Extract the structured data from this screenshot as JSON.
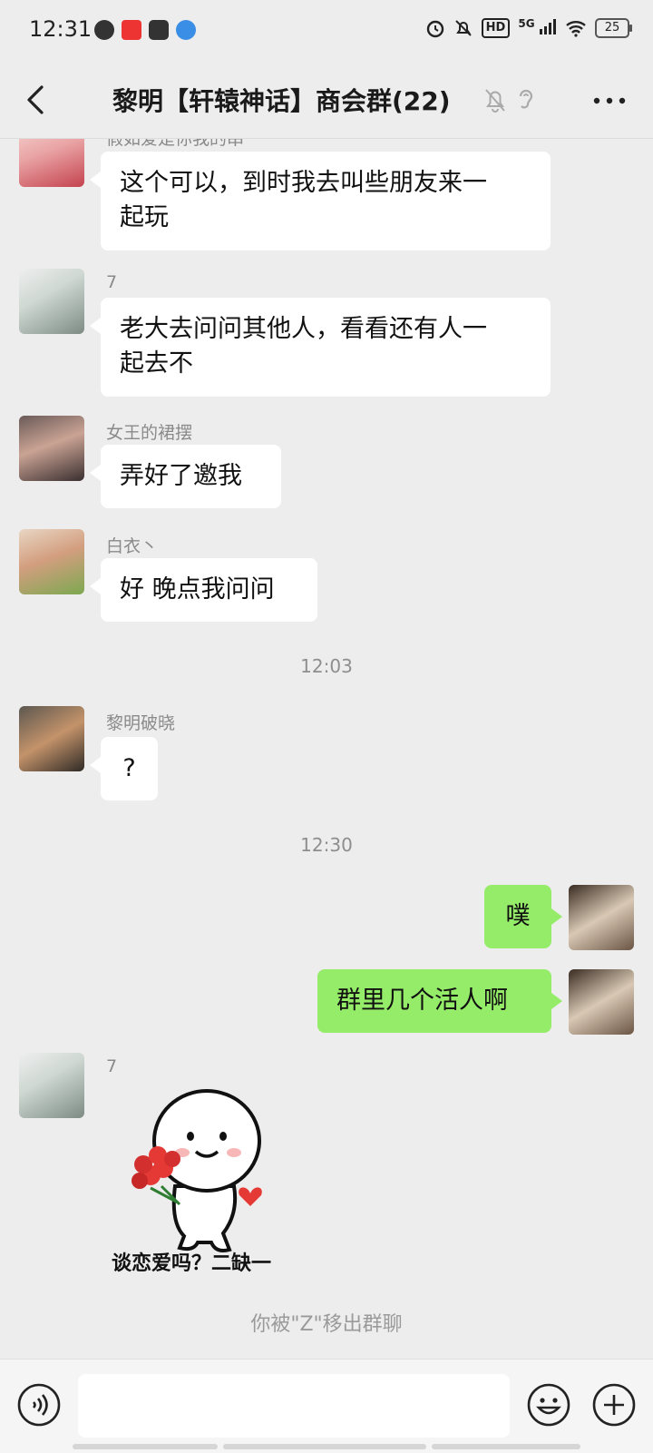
{
  "status_bar": {
    "time": "12:31",
    "network": "5G",
    "hd": "HD",
    "battery": "25"
  },
  "header": {
    "title": "黎明【轩辕神话】商会群(22)"
  },
  "messages": [
    {
      "sender": "假如爱是你我的串",
      "text_line1": "这个可以，到时我去叫些朋友来一",
      "text_line2": "起玩"
    },
    {
      "sender": "7",
      "text_line1": "老大去问问其他人，看看还有人一",
      "text_line2": "起去不"
    },
    {
      "sender": "女王的裙摆",
      "text": "弄好了邀我"
    },
    {
      "sender": "白衣丶",
      "text": "好 晚点我问问"
    },
    {
      "sender": "黎明破晓",
      "text": "?"
    },
    {
      "sender": "7",
      "sticker_caption": "谈恋爱吗？二缺一"
    }
  ],
  "timestamps": [
    "12:03",
    "12:30"
  ],
  "outgoing": [
    {
      "text": "噗"
    },
    {
      "text": "群里几个活人啊"
    }
  ],
  "system_notice": "你被\"Z\"移出群聊",
  "input": {
    "placeholder": ""
  }
}
